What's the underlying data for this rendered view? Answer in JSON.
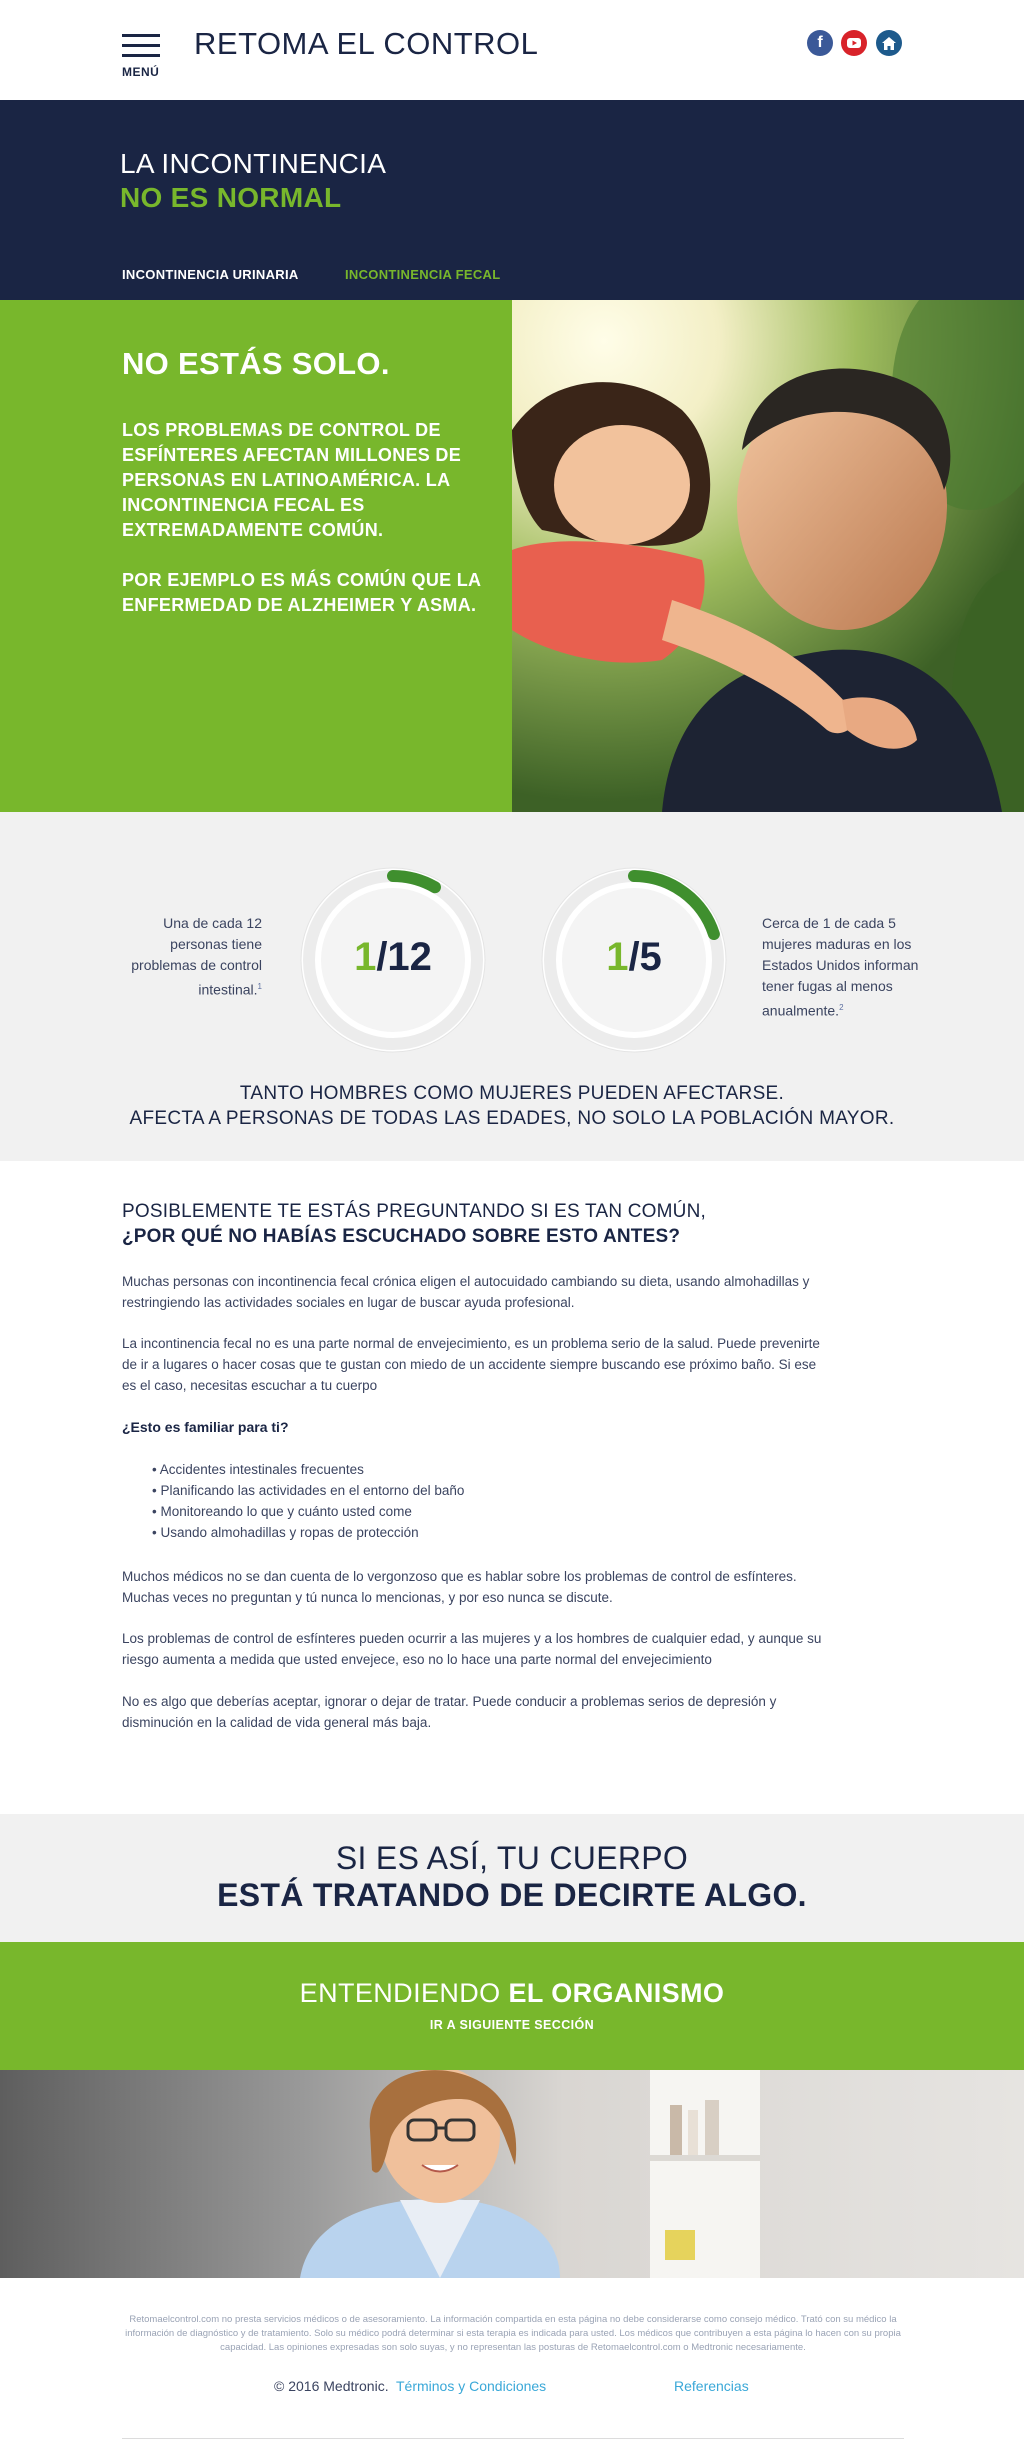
{
  "header": {
    "menu_label": "MENÚ",
    "site_title": "RETOMA EL CONTROL",
    "social": {
      "facebook": "f",
      "youtube": "▶",
      "home": "⌂"
    }
  },
  "intro": {
    "line1": "LA INCONTINENCIA",
    "line2": "NO ES NORMAL",
    "tabs": [
      {
        "label": "INCONTINENCIA URINARIA"
      },
      {
        "label": "INCONTINENCIA FECAL"
      }
    ]
  },
  "hero": {
    "title": "NO ESTÁS SOLO.",
    "paragraph1": "LOS PROBLEMAS DE CONTROL DE ESFÍNTERES AFECTAN MILLONES DE PERSONAS EN LATINOAMÉRICA. LA INCONTINENCIA FECAL ES EXTREMADAMENTE COMÚN.",
    "paragraph2": "POR EJEMPLO ES MÁS COMÚN QUE LA ENFERMEDAD DE ALZHEIMER Y ASMA."
  },
  "stats": {
    "left_text": "Una de cada 12 personas tiene problemas de control intestinal.",
    "left_ref": "1",
    "ring1": {
      "numerator": "1",
      "rest": "/12",
      "fraction": 0.0833
    },
    "ring2": {
      "numerator": "1",
      "rest": "/5",
      "fraction": 0.2
    },
    "right_text": "Cerca de 1 de cada 5 mujeres maduras en los Estados Unidos informan tener fugas al menos anualmente.",
    "right_ref": "2",
    "caption1": "TANTO HOMBRES COMO MUJERES PUEDEN AFECTARSE.",
    "caption2": "AFECTA A PERSONAS DE TODAS LAS EDADES, NO SOLO LA POBLACIÓN MAYOR."
  },
  "article": {
    "heading1": "POSIBLEMENTE TE ESTÁS PREGUNTANDO SI ES TAN COMÚN,",
    "heading2": "¿POR QUÉ NO HABÍAS ESCUCHADO SOBRE ESTO ANTES?",
    "p1": "Muchas personas con incontinencia fecal crónica eligen el autocuidado cambiando su dieta, usando almohadillas y restringiendo las actividades sociales en lugar de buscar ayuda profesional.",
    "p2": "La incontinencia fecal no es una parte normal de envejecimiento, es un problema serio de la salud. Puede prevenirte de ir a lugares o hacer cosas que te gustan con miedo de un accidente siempre buscando ese próximo baño. Si ese es el caso, necesitas escuchar a tu cuerpo",
    "question": "¿Esto es familiar para ti?",
    "list": [
      "Accidentes intestinales frecuentes",
      "Planificando las actividades en el entorno del baño",
      "Monitoreando lo que y cuánto usted come",
      "Usando almohadillas y ropas de protección"
    ],
    "p3": "Muchos médicos no se dan cuenta de lo vergonzoso que es hablar sobre los problemas de control de esfínteres. Muchas veces no preguntan y tú nunca lo mencionas, y por eso nunca se discute.",
    "p4": "Los problemas de control de esfínteres pueden ocurrir a las mujeres y a los hombres de cualquier edad, y aunque su riesgo aumenta a medida que usted envejece, eso no lo hace una parte normal del envejecimiento",
    "p5": "No es algo que deberías aceptar, ignorar o dejar de tratar. Puede conducir a problemas serios de depresión y disminución en la calidad de vida general más baja."
  },
  "callout": {
    "line1": "SI ES ASÍ, TU CUERPO",
    "line2": "ESTÁ TRATANDO DE DECIRTE ALGO."
  },
  "next_section": {
    "title_light": "ENTENDIENDO ",
    "title_bold": "EL ORGANISMO",
    "link": "IR A SIGUIENTE SECCIÓN"
  },
  "footer": {
    "disclaimer": "Retomaelcontrol.com no presta servicios médicos o de asesoramiento. La información compartida en esta página no debe considerarse como consejo médico. Trató con su médico la información de diagnóstico y de tratamiento. Solo su médico podrá determinar si esta terapia es indicada para usted. Los médicos que contribuyen a esta página lo hacen con su propia capacidad. Las opiniones expresadas son solo suyas, y no representan las posturas de Retomaelcontrol.com o Medtronic necesariamente.",
    "copyright": "© 2016 Medtronic.",
    "terms": "Términos y Condiciones",
    "references": "Referencias"
  },
  "colors": {
    "navy": "#1a2544",
    "green": "#78b72c",
    "light_grey": "#f1f1f1",
    "link_blue": "#3aa8d8"
  }
}
